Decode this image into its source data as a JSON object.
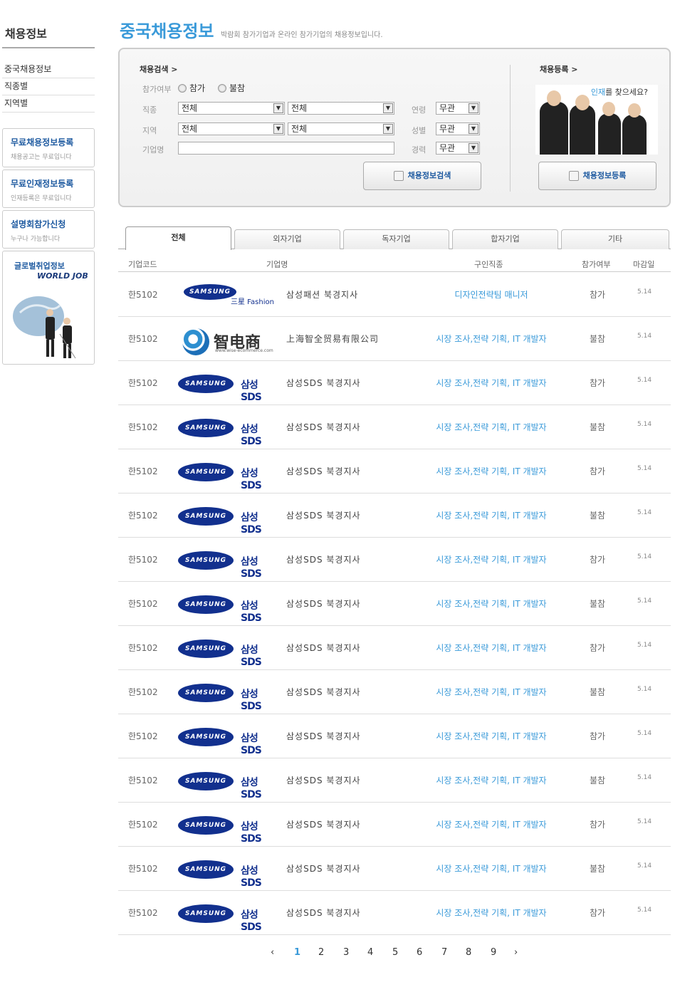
{
  "sidebar": {
    "title": "채용정보",
    "menu": [
      "중국채용정보",
      "직종별",
      "지역별"
    ],
    "boxes": [
      {
        "title": "무료채용정보등록",
        "sub": "채용공고는 무료입니다"
      },
      {
        "title": "무료인재정보등록",
        "sub": "인재등록은 무료입니다"
      },
      {
        "title": "설명회참가신청",
        "sub": "누구나 가능합니다"
      }
    ],
    "global": {
      "title": "글로벌취업정보",
      "logo": "WORLD JOB"
    }
  },
  "header": {
    "title": "중국채용정보",
    "subtitle": "박람회 참가기업과 온라인 참가기업의 채용정보입니다."
  },
  "search": {
    "heading": "채용검색 >",
    "register_heading": "채용등록 >",
    "labels": {
      "participation": "참가여부",
      "job": "직종",
      "region": "지역",
      "company": "기업명",
      "age": "연령",
      "gender": "성별",
      "career": "경력"
    },
    "radio_options": [
      "참가",
      "불참"
    ],
    "job_select_1": "전체",
    "job_select_2": "전체",
    "region_select_1": "전체",
    "region_select_2": "전체",
    "age_select": "무관",
    "gender_select": "무관",
    "career_select": "무관",
    "company_value": "",
    "search_button": "채용정보검색",
    "register_button": "채용정보등록",
    "promo_text_highlight": "인재",
    "promo_text_rest": "를 찾으세요?"
  },
  "tabs": [
    "전체",
    "외자기업",
    "독자기업",
    "합자기업",
    "기타"
  ],
  "table": {
    "headers": [
      "기업코드",
      "기업명",
      "구인직종",
      "참가여부",
      "마감일"
    ],
    "rows": [
      {
        "code": "한5102",
        "logo": "samsung-fashion",
        "logo_badge": "SAMSUNG",
        "logo_text": "三星 Fashion",
        "name": "삼성패션 북경지사",
        "job": "디자인전략팀 매니저",
        "participation": "참가",
        "deadline": "5.14"
      },
      {
        "code": "한5102",
        "logo": "wise",
        "logo_text": "智电商",
        "logo_url": "www.wise-ecommerce.com",
        "name": "上海智全贸易有限公司",
        "job": "시장 조사,전략 기획, IT 개발자",
        "participation": "불참",
        "deadline": "5.14"
      },
      {
        "code": "한5102",
        "logo": "samsung-sds",
        "logo_badge": "SAMSUNG",
        "logo_text": "삼성SDS",
        "name": "삼성SDS 북경지사",
        "job": "시장 조사,전략 기획, IT 개발자",
        "participation": "참가",
        "deadline": "5.14"
      },
      {
        "code": "한5102",
        "logo": "samsung-sds",
        "logo_badge": "SAMSUNG",
        "logo_text": "삼성SDS",
        "name": "삼성SDS 북경지사",
        "job": "시장 조사,전략 기획, IT 개발자",
        "participation": "불참",
        "deadline": "5.14"
      },
      {
        "code": "한5102",
        "logo": "samsung-sds",
        "logo_badge": "SAMSUNG",
        "logo_text": "삼성SDS",
        "name": "삼성SDS 북경지사",
        "job": "시장 조사,전략 기획, IT 개발자",
        "participation": "참가",
        "deadline": "5.14"
      },
      {
        "code": "한5102",
        "logo": "samsung-sds",
        "logo_badge": "SAMSUNG",
        "logo_text": "삼성SDS",
        "name": "삼성SDS 북경지사",
        "job": "시장 조사,전략 기획, IT 개발자",
        "participation": "불참",
        "deadline": "5.14"
      },
      {
        "code": "한5102",
        "logo": "samsung-sds",
        "logo_badge": "SAMSUNG",
        "logo_text": "삼성SDS",
        "name": "삼성SDS 북경지사",
        "job": "시장 조사,전략 기획, IT 개발자",
        "participation": "참가",
        "deadline": "5.14"
      },
      {
        "code": "한5102",
        "logo": "samsung-sds",
        "logo_badge": "SAMSUNG",
        "logo_text": "삼성SDS",
        "name": "삼성SDS 북경지사",
        "job": "시장 조사,전략 기획, IT 개발자",
        "participation": "불참",
        "deadline": "5.14"
      },
      {
        "code": "한5102",
        "logo": "samsung-sds",
        "logo_badge": "SAMSUNG",
        "logo_text": "삼성SDS",
        "name": "삼성SDS 북경지사",
        "job": "시장 조사,전략 기획, IT 개발자",
        "participation": "참가",
        "deadline": "5.14"
      },
      {
        "code": "한5102",
        "logo": "samsung-sds",
        "logo_badge": "SAMSUNG",
        "logo_text": "삼성SDS",
        "name": "삼성SDS 북경지사",
        "job": "시장 조사,전략 기획, IT 개발자",
        "participation": "불참",
        "deadline": "5.14"
      },
      {
        "code": "한5102",
        "logo": "samsung-sds",
        "logo_badge": "SAMSUNG",
        "logo_text": "삼성SDS",
        "name": "삼성SDS 북경지사",
        "job": "시장 조사,전략 기획, IT 개발자",
        "participation": "참가",
        "deadline": "5.14"
      },
      {
        "code": "한5102",
        "logo": "samsung-sds",
        "logo_badge": "SAMSUNG",
        "logo_text": "삼성SDS",
        "name": "삼성SDS 북경지사",
        "job": "시장 조사,전략 기획, IT 개발자",
        "participation": "불참",
        "deadline": "5.14"
      },
      {
        "code": "한5102",
        "logo": "samsung-sds",
        "logo_badge": "SAMSUNG",
        "logo_text": "삼성SDS",
        "name": "삼성SDS 북경지사",
        "job": "시장 조사,전략 기획, IT 개발자",
        "participation": "참가",
        "deadline": "5.14"
      },
      {
        "code": "한5102",
        "logo": "samsung-sds",
        "logo_badge": "SAMSUNG",
        "logo_text": "삼성SDS",
        "name": "삼성SDS 북경지사",
        "job": "시장 조사,전략 기획, IT 개발자",
        "participation": "불참",
        "deadline": "5.14"
      },
      {
        "code": "한5102",
        "logo": "samsung-sds",
        "logo_badge": "SAMSUNG",
        "logo_text": "삼성SDS",
        "name": "삼성SDS 북경지사",
        "job": "시장 조사,전략 기획, IT 개발자",
        "participation": "참가",
        "deadline": "5.14"
      }
    ]
  },
  "pagination": {
    "prev": "‹",
    "next": "›",
    "pages": [
      "1",
      "2",
      "3",
      "4",
      "5",
      "6",
      "7",
      "8",
      "9"
    ],
    "current": "1"
  },
  "colors": {
    "accent": "#3a9ad9",
    "brand_blue": "#12308e",
    "link_blue": "#1e5aa0"
  }
}
